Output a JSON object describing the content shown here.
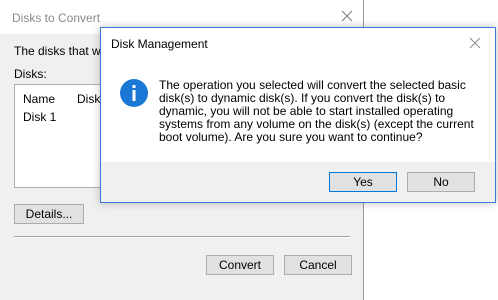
{
  "background_dialog": {
    "title": "Disks to Convert",
    "intro_label": "The disks that will b",
    "disks_label": "Disks:",
    "columns": [
      "Name",
      "Disk"
    ],
    "rows": [
      {
        "name": "Disk 1"
      }
    ],
    "details_label": "Details...",
    "convert_label": "Convert",
    "cancel_label": "Cancel"
  },
  "modal": {
    "title": "Disk Management",
    "message": "The operation you selected will convert the selected basic disk(s) to dynamic disk(s). If you convert the disk(s) to dynamic, you will not be able to start installed operating systems from any volume on the disk(s) (except the current boot volume). Are you sure you want to continue?",
    "yes_label": "Yes",
    "no_label": "No",
    "icon": "info-icon"
  },
  "colors": {
    "accent": "#0078d7",
    "info_icon_bg": "#1a78d4"
  }
}
